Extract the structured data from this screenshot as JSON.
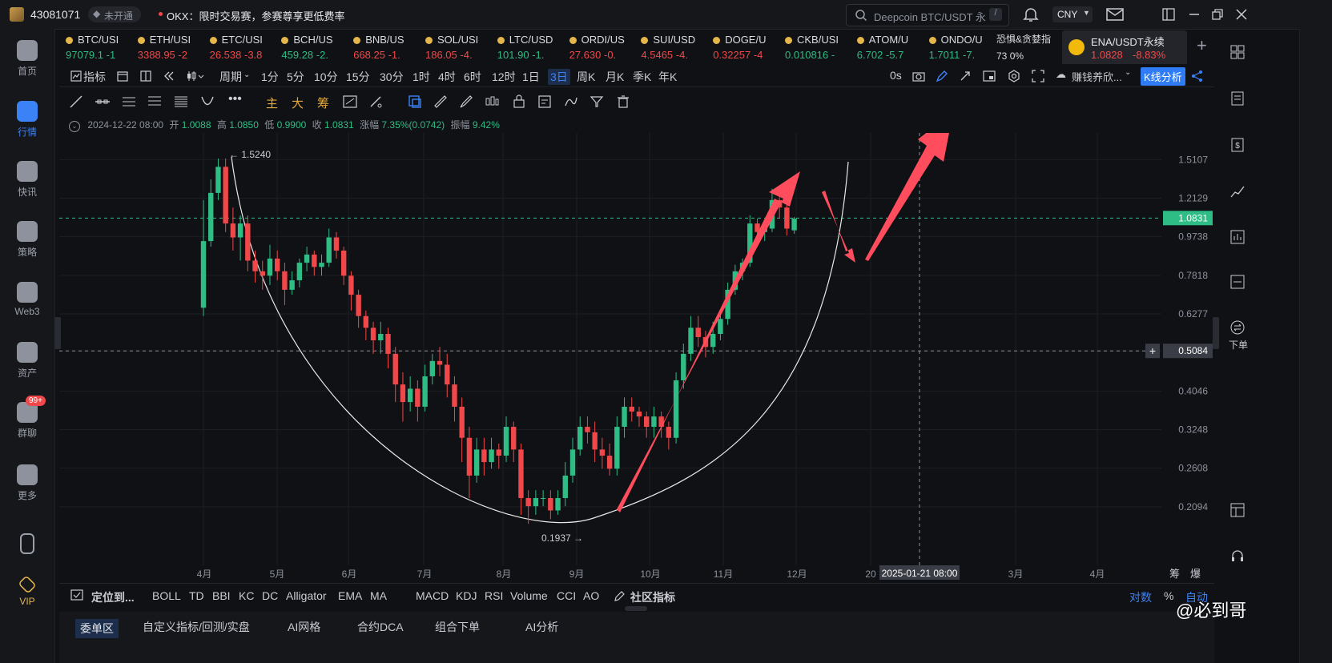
{
  "topbar": {
    "account_id": "43081071",
    "badge": "未开通",
    "notice": "OKX：限时交易赛，参赛尊享更低费率",
    "search_placeholder": "Deepcoin BTC/USDT 永续",
    "search_shortcut": "/",
    "currency": "CNY"
  },
  "left_nav": [
    {
      "label": "首页",
      "icon": "home-icon"
    },
    {
      "label": "行情",
      "icon": "market-icon"
    },
    {
      "label": "快讯",
      "icon": "news-icon"
    },
    {
      "label": "策略",
      "icon": "robot-icon"
    },
    {
      "label": "Web3",
      "icon": "web3-icon"
    },
    {
      "label": "资产",
      "icon": "wallet-icon"
    },
    {
      "label": "群聊",
      "icon": "chat-icon",
      "badge": "99+"
    },
    {
      "label": "更多",
      "icon": "more-icon"
    },
    {
      "label": "",
      "icon": "phone-icon"
    },
    {
      "label": "VIP",
      "icon": "vip-icon"
    }
  ],
  "tickers": [
    {
      "name": "BTC/USI",
      "price": "97079.1",
      "change": "-1",
      "dir": "up"
    },
    {
      "name": "ETH/USI",
      "price": "3388.95",
      "change": "-2",
      "dir": "dn"
    },
    {
      "name": "ETC/USI",
      "price": "26.538",
      "change": "-3.8",
      "dir": "dn"
    },
    {
      "name": "BCH/US",
      "price": "459.28",
      "change": "-2.",
      "dir": "up"
    },
    {
      "name": "BNB/US",
      "price": "668.25",
      "change": "-1.",
      "dir": "dn"
    },
    {
      "name": "SOL/USI",
      "price": "186.05",
      "change": "-4.",
      "dir": "dn"
    },
    {
      "name": "LTC/USD",
      "price": "101.90",
      "change": "-1.",
      "dir": "up"
    },
    {
      "name": "ORDI/US",
      "price": "27.630",
      "change": "-0.",
      "dir": "dn"
    },
    {
      "name": "SUI/USD",
      "price": "4.5465",
      "change": "-4.",
      "dir": "dn"
    },
    {
      "name": "DOGE/U",
      "price": "0.32257",
      "change": "-4",
      "dir": "dn"
    },
    {
      "name": "CKB/USI",
      "price": "0.010816",
      "change": "-",
      "dir": "up"
    },
    {
      "name": "ATOM/U",
      "price": "6.702",
      "change": "-5.7",
      "dir": "up"
    },
    {
      "name": "ONDO/U",
      "price": "1.7011",
      "change": "-7.",
      "dir": "up"
    }
  ],
  "fear_greed": {
    "label": "恐惧&贪婪指",
    "value": "73",
    "change": "0%"
  },
  "active_pair": {
    "name": "ENA/USDT永续",
    "price": "1.0828",
    "change": "-8.83%"
  },
  "timeframes": [
    "指标",
    "周期",
    "1分",
    "5分",
    "10分",
    "15分",
    "30分",
    "1时",
    "4时",
    "6时",
    "12时",
    "1日",
    "3日",
    "周K",
    "月K",
    "季K",
    "年K"
  ],
  "active_timeframe": "3日",
  "toolbar_right": {
    "latency": "0s",
    "indicator_select": "赚钱养欣...",
    "kline_button": "K线分析"
  },
  "draw_tools_colored": [
    "主",
    "大",
    "筹"
  ],
  "ohlc": {
    "date": "2024-12-22 08:00",
    "open_label": "开",
    "open": "1.0088",
    "high_label": "高",
    "high": "1.0850",
    "low_label": "低",
    "low": "0.9900",
    "close_label": "收",
    "close": "1.0831",
    "amp_label": "涨幅",
    "amp": "7.35%(0.0742)",
    "swing_label": "振幅",
    "swing": "9.42%"
  },
  "chart_data": {
    "type": "candlestick",
    "price_axis": [
      "1.5107",
      "1.2129",
      "0.9738",
      "0.7818",
      "0.6277",
      "0.5084",
      "0.4046",
      "0.3248",
      "0.2608",
      "0.2094"
    ],
    "current_price": "1.0831",
    "crosshair_price": "0.5084",
    "crosshair_time": "2025-01-21 08:00",
    "high_marker": "1.5240",
    "low_marker": "0.1937",
    "x_labels": [
      "4月",
      "5月",
      "6月",
      "7月",
      "8月",
      "9月",
      "10月",
      "11月",
      "12月",
      "20",
      "3月",
      "4月"
    ],
    "corner_labels": [
      "筹",
      "爆"
    ],
    "log_scale": true,
    "candles": [
      [
        0.65,
        0.95,
        0.62,
        1.2
      ],
      [
        0.95,
        1.25,
        0.92,
        1.35
      ],
      [
        1.25,
        1.45,
        1.2,
        1.52
      ],
      [
        1.45,
        1.05,
        1.0,
        1.52
      ],
      [
        1.05,
        0.97,
        0.9,
        1.15
      ],
      [
        0.97,
        1.05,
        0.85,
        1.1
      ],
      [
        1.05,
        0.85,
        0.8,
        1.1
      ],
      [
        0.85,
        0.8,
        0.75,
        0.9
      ],
      [
        0.8,
        0.78,
        0.72,
        0.85
      ],
      [
        0.78,
        0.86,
        0.74,
        0.93
      ],
      [
        0.86,
        0.8,
        0.76,
        0.9
      ],
      [
        0.8,
        0.72,
        0.66,
        0.84
      ],
      [
        0.72,
        0.76,
        0.7,
        0.8
      ],
      [
        0.76,
        0.84,
        0.73,
        0.86
      ],
      [
        0.84,
        0.88,
        0.8,
        0.92
      ],
      [
        0.88,
        0.82,
        0.78,
        0.9
      ],
      [
        0.82,
        0.84,
        0.78,
        0.88
      ],
      [
        0.84,
        0.97,
        0.82,
        1.02
      ],
      [
        0.97,
        0.9,
        0.86,
        1.0
      ],
      [
        0.9,
        0.78,
        0.74,
        0.92
      ],
      [
        0.78,
        0.7,
        0.64,
        0.8
      ],
      [
        0.7,
        0.62,
        0.58,
        0.72
      ],
      [
        0.62,
        0.58,
        0.54,
        0.64
      ],
      [
        0.58,
        0.54,
        0.5,
        0.6
      ],
      [
        0.54,
        0.56,
        0.5,
        0.6
      ],
      [
        0.56,
        0.5,
        0.46,
        0.58
      ],
      [
        0.5,
        0.42,
        0.38,
        0.52
      ],
      [
        0.42,
        0.38,
        0.34,
        0.45
      ],
      [
        0.38,
        0.41,
        0.36,
        0.44
      ],
      [
        0.41,
        0.37,
        0.34,
        0.43
      ],
      [
        0.37,
        0.44,
        0.36,
        0.47
      ],
      [
        0.44,
        0.48,
        0.42,
        0.5
      ],
      [
        0.48,
        0.47,
        0.44,
        0.52
      ],
      [
        0.47,
        0.42,
        0.39,
        0.5
      ],
      [
        0.42,
        0.37,
        0.34,
        0.44
      ],
      [
        0.37,
        0.31,
        0.27,
        0.39
      ],
      [
        0.31,
        0.25,
        0.22,
        0.33
      ],
      [
        0.25,
        0.29,
        0.24,
        0.31
      ],
      [
        0.29,
        0.27,
        0.25,
        0.31
      ],
      [
        0.27,
        0.29,
        0.26,
        0.31
      ],
      [
        0.29,
        0.28,
        0.26,
        0.3
      ],
      [
        0.28,
        0.33,
        0.27,
        0.35
      ],
      [
        0.33,
        0.29,
        0.27,
        0.34
      ],
      [
        0.29,
        0.22,
        0.2,
        0.3
      ],
      [
        0.22,
        0.21,
        0.19,
        0.23
      ],
      [
        0.21,
        0.22,
        0.2,
        0.23
      ],
      [
        0.22,
        0.22,
        0.21,
        0.23
      ],
      [
        0.22,
        0.205,
        0.195,
        0.23
      ],
      [
        0.205,
        0.22,
        0.2,
        0.23
      ],
      [
        0.22,
        0.25,
        0.21,
        0.27
      ],
      [
        0.25,
        0.29,
        0.24,
        0.31
      ],
      [
        0.29,
        0.33,
        0.28,
        0.35
      ],
      [
        0.33,
        0.32,
        0.3,
        0.35
      ],
      [
        0.32,
        0.29,
        0.27,
        0.34
      ],
      [
        0.29,
        0.28,
        0.26,
        0.31
      ],
      [
        0.28,
        0.26,
        0.25,
        0.3
      ],
      [
        0.26,
        0.33,
        0.25,
        0.35
      ],
      [
        0.33,
        0.37,
        0.31,
        0.39
      ],
      [
        0.37,
        0.36,
        0.34,
        0.39
      ],
      [
        0.36,
        0.35,
        0.33,
        0.37
      ],
      [
        0.35,
        0.33,
        0.31,
        0.36
      ],
      [
        0.33,
        0.35,
        0.31,
        0.37
      ],
      [
        0.35,
        0.33,
        0.31,
        0.36
      ],
      [
        0.33,
        0.31,
        0.29,
        0.34
      ],
      [
        0.31,
        0.43,
        0.3,
        0.45
      ],
      [
        0.43,
        0.5,
        0.41,
        0.53
      ],
      [
        0.5,
        0.58,
        0.48,
        0.62
      ],
      [
        0.58,
        0.55,
        0.52,
        0.62
      ],
      [
        0.55,
        0.52,
        0.49,
        0.57
      ],
      [
        0.52,
        0.56,
        0.5,
        0.6
      ],
      [
        0.56,
        0.61,
        0.54,
        0.63
      ],
      [
        0.61,
        0.72,
        0.59,
        0.75
      ],
      [
        0.72,
        0.8,
        0.7,
        0.83
      ],
      [
        0.8,
        0.84,
        0.76,
        0.86
      ],
      [
        0.84,
        1.05,
        0.82,
        1.1
      ],
      [
        1.05,
        1.0,
        0.96,
        1.08
      ],
      [
        1.0,
        1.02,
        0.95,
        1.06
      ],
      [
        1.02,
        1.2,
        1.0,
        1.28
      ],
      [
        1.2,
        1.15,
        1.08,
        1.3
      ],
      [
        1.15,
        1.02,
        0.98,
        1.18
      ],
      [
        1.01,
        1.08,
        0.99,
        1.09
      ]
    ]
  },
  "bottom_bar": {
    "locate": "定位到...",
    "indicators": [
      "BOLL",
      "TD",
      "BBI",
      "KC",
      "DC",
      "Alligator",
      "EMA",
      "MA",
      "MACD",
      "KDJ",
      "RSI",
      "Volume",
      "CCI",
      "AO"
    ],
    "community": "社区指标",
    "right": [
      "对数",
      "%",
      "自动"
    ]
  },
  "bottom_tabs": [
    "委单区",
    "自定义指标/回测/实盘",
    "AI网格",
    "合约DCA",
    "组合下单",
    "AI分析"
  ],
  "right_bar": {
    "order_label": "下单"
  },
  "watermark": "@必到哥",
  "colors": {
    "up": "#2ebd85",
    "down": "#f0484a",
    "accent": "#2f7cf6",
    "arrow": "#ff4d5e"
  }
}
